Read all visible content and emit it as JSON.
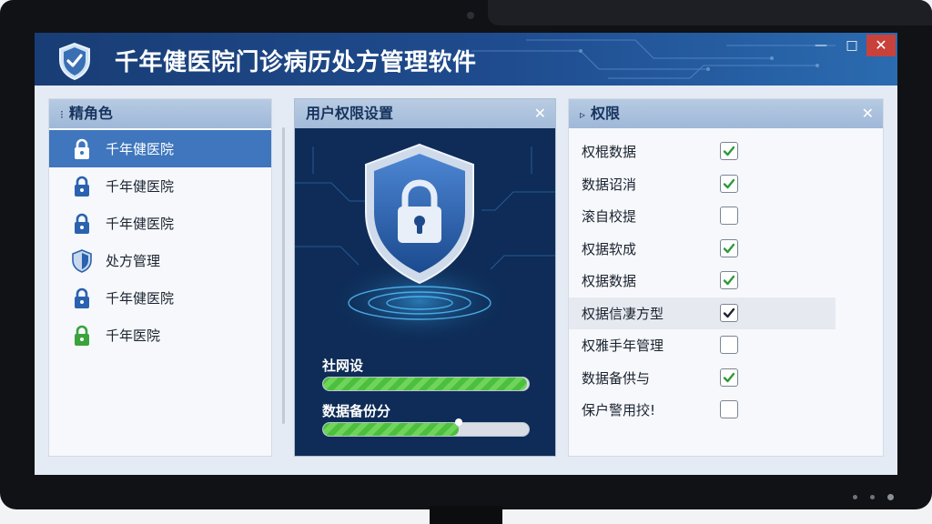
{
  "app": {
    "title": "千年健医院门诊病历处方管理软件",
    "window_controls": {
      "minimize": "—",
      "maximize": "□",
      "close": "✕"
    }
  },
  "roles_panel": {
    "title": "精角色",
    "header_icon": "⁝",
    "items": [
      {
        "label": "千年健医院",
        "icon": "lock-icon",
        "icon_color": "#ffffff",
        "selected": true
      },
      {
        "label": "千年健医院",
        "icon": "lock-icon",
        "icon_color": "#2a62b0",
        "selected": false
      },
      {
        "label": "千年健医院",
        "icon": "lock-icon",
        "icon_color": "#2a62b0",
        "selected": false
      },
      {
        "label": "处方管理",
        "icon": "shield-icon",
        "icon_color": "#2a62b0",
        "selected": false
      },
      {
        "label": "千年健医院",
        "icon": "lock-icon",
        "icon_color": "#2a62b0",
        "selected": false
      },
      {
        "label": "千年医院",
        "icon": "lock-icon",
        "icon_color": "#3aa33c",
        "selected": false
      }
    ]
  },
  "settings_panel": {
    "title": "用户权限设置",
    "close": "✕",
    "progress": [
      {
        "label": "社网设",
        "fraction": 0.99
      },
      {
        "label": "数据备份分",
        "fraction": 0.66
      }
    ]
  },
  "perms_panel": {
    "title": "权限",
    "header_icon": "▹",
    "close": "✕",
    "rows": [
      {
        "label": "权棍数据",
        "checked": true,
        "highlight": false
      },
      {
        "label": "数据诏消",
        "checked": true,
        "highlight": false
      },
      {
        "label": "滚自校提",
        "checked": false,
        "highlight": false
      },
      {
        "label": "权据软成",
        "checked": true,
        "highlight": false
      },
      {
        "label": "权据数据",
        "checked": true,
        "highlight": false
      },
      {
        "label": "权据信凄方型",
        "checked": true,
        "highlight": true
      },
      {
        "label": "权雅手年管理",
        "checked": false,
        "highlight": false
      },
      {
        "label": "数据备供与",
        "checked": true,
        "highlight": false
      },
      {
        "label": "保户警用挍!",
        "checked": false,
        "highlight": false
      }
    ]
  },
  "colors": {
    "titlebar": "#1f4c8f",
    "selected_row": "#3f76bd",
    "check_green": "#2c9a3a",
    "check_black": "#1b2330",
    "progress_green": "#4cbf3c",
    "close_red": "#c8423b"
  }
}
